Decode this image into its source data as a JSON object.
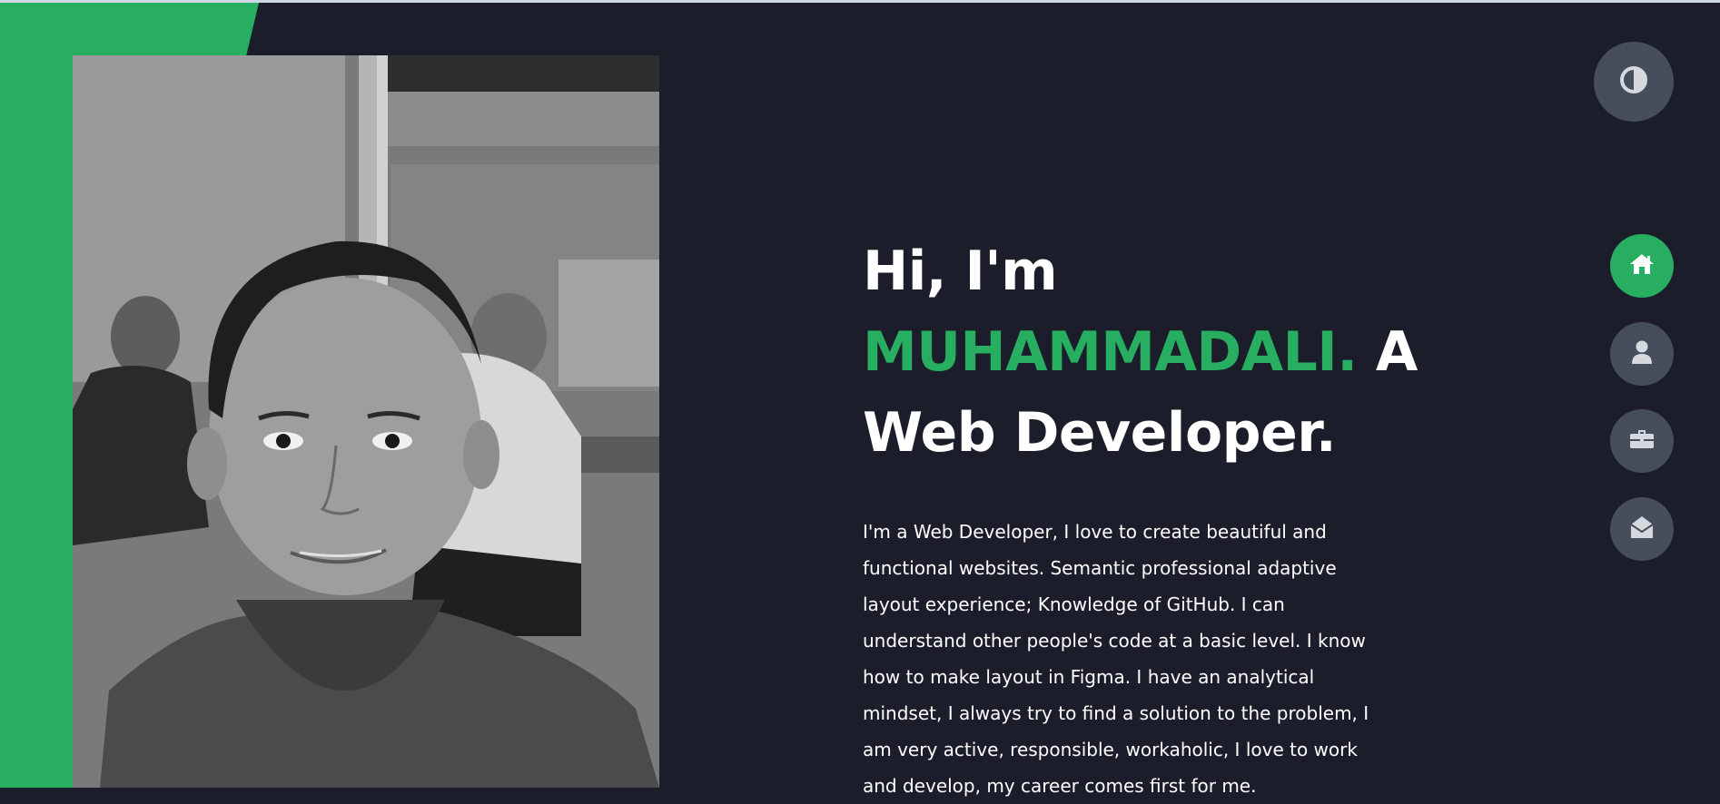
{
  "hero": {
    "greeting": "Hi, I'm",
    "name": "MUHAMMADALI.",
    "role_a": " A",
    "role": "Web Developer.",
    "description": "I'm a Web Developer, I love to create beautiful and functional websites. Semantic professional adaptive layout experience; Knowledge of GitHub. I can understand other people's code at a basic level. I know how to make layout in Figma. I have an analytical mindset, I always try to find a solution to the problem, I am very active, responsible, workaholic, I love to work and develop, my career comes first for me."
  },
  "controls": {
    "theme_toggle_icon": "contrast-icon"
  },
  "nav": {
    "items": [
      {
        "icon": "home-icon",
        "active": true
      },
      {
        "icon": "user-icon",
        "active": false
      },
      {
        "icon": "briefcase-icon",
        "active": false
      },
      {
        "icon": "envelope-open-icon",
        "active": false
      }
    ]
  },
  "colors": {
    "background": "#1b1d2b",
    "accent": "#27ae60",
    "button": "#454e5a",
    "text": "#ffffff"
  }
}
